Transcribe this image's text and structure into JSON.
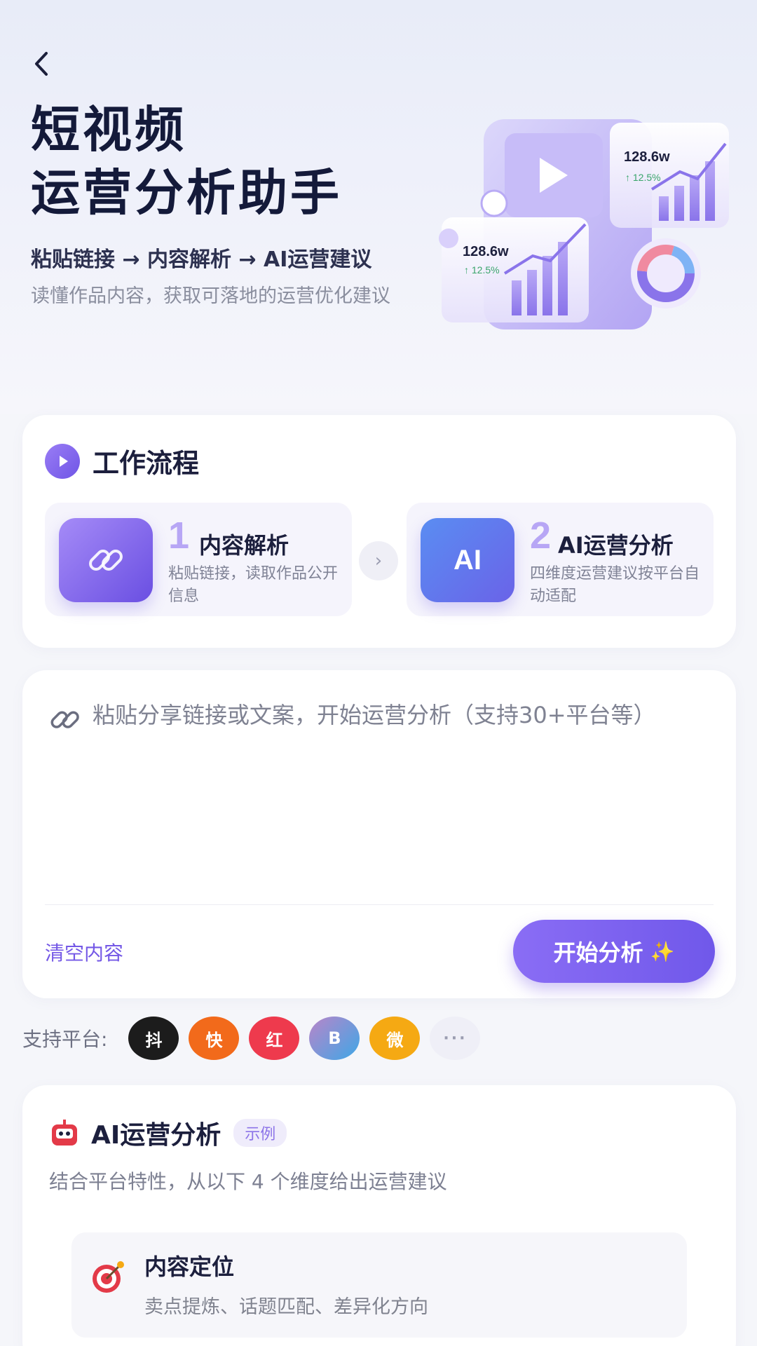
{
  "hero": {
    "title_line1": "短视频",
    "title_line2": "运营分析助手",
    "flow": "粘贴链接 → 内容解析 → AI运营建议",
    "description": "读懂作品内容，获取可落地的运营优化建议",
    "illustration": {
      "stat_top_value": "128.6w",
      "stat_top_change": "↑ 12.5%",
      "stat_bottom_value": "128.6w",
      "stat_bottom_change": "↑ 12.5%"
    }
  },
  "workflow": {
    "title": "工作流程",
    "steps": [
      {
        "number": "1",
        "name": "内容解析",
        "desc": "粘贴链接，读取作品公开信息",
        "icon": "link-icon"
      },
      {
        "number": "2",
        "name": "AI运营分析",
        "desc": "四维度运营建议按平台自动适配",
        "tile_text": "AI"
      }
    ],
    "arrow": "›"
  },
  "input": {
    "placeholder": "粘贴分享链接或文案，开始运营分析（支持30+平台等）",
    "clear_label": "清空内容",
    "start_label": "开始分析",
    "sparkle": "✨"
  },
  "platforms": {
    "label": "支持平台:",
    "items": [
      {
        "char": "抖",
        "color": "#1c1c1c"
      },
      {
        "char": "快",
        "color": "#f26a1b"
      },
      {
        "char": "红",
        "color": "#ee3a4d"
      },
      {
        "char": "B",
        "color": "#7b8ee0"
      },
      {
        "char": "微",
        "color": "#f5a913"
      }
    ],
    "more": "···"
  },
  "analysis": {
    "title": "AI运营分析",
    "badge": "示例",
    "subtitle": "结合平台特性，从以下 4 个维度给出运营建议",
    "dimensions": [
      {
        "title": "内容定位",
        "desc": "卖点提炼、话题匹配、差异化方向"
      }
    ]
  }
}
